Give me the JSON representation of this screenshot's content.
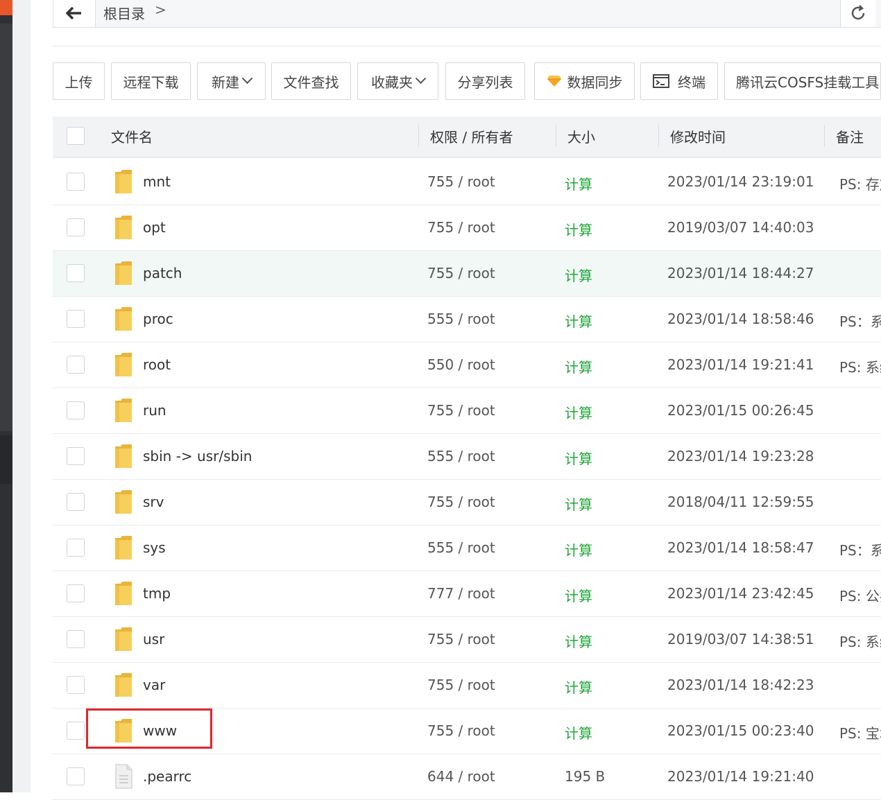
{
  "pathbar": {
    "crumb": "根目录",
    "crumb_arrow": ">"
  },
  "toolbar": {
    "buttons": [
      {
        "label": "上传"
      },
      {
        "label": "远程下载"
      },
      {
        "label": "新建"
      },
      {
        "label": "文件查找"
      },
      {
        "label": "收藏夹"
      },
      {
        "label": "分享列表"
      },
      {
        "label": "数据同步"
      },
      {
        "label": "终端"
      },
      {
        "label": "腾讯云COSFS挂载工具"
      }
    ]
  },
  "table": {
    "headers": {
      "name": "文件名",
      "perm": "权限 / 所有者",
      "size": "大小",
      "mtime": "修改时间",
      "note": "备注"
    },
    "rows": [
      {
        "name": "mnt",
        "perm": "755 / root",
        "size": "计算",
        "mtime": "2023/01/14 23:19:01",
        "note": "PS: 存放"
      },
      {
        "name": "opt",
        "perm": "755 / root",
        "size": "计算",
        "mtime": "2019/03/07 14:40:03",
        "note": ""
      },
      {
        "name": "patch",
        "perm": "755 / root",
        "size": "计算",
        "mtime": "2023/01/14 18:44:27",
        "note": ""
      },
      {
        "name": "proc",
        "perm": "555 / root",
        "size": "计算",
        "mtime": "2023/01/14 18:58:46",
        "note": "PS：系"
      },
      {
        "name": "root",
        "perm": "550 / root",
        "size": "计算",
        "mtime": "2023/01/14 19:21:41",
        "note": "PS: 系统"
      },
      {
        "name": "run",
        "perm": "755 / root",
        "size": "计算",
        "mtime": "2023/01/15 00:26:45",
        "note": ""
      },
      {
        "name": "sbin -> usr/sbin",
        "perm": "555 / root",
        "size": "计算",
        "mtime": "2023/01/14 19:23:28",
        "note": ""
      },
      {
        "name": "srv",
        "perm": "755 / root",
        "size": "计算",
        "mtime": "2018/04/11 12:59:55",
        "note": ""
      },
      {
        "name": "sys",
        "perm": "555 / root",
        "size": "计算",
        "mtime": "2023/01/14 18:58:47",
        "note": "PS：系"
      },
      {
        "name": "tmp",
        "perm": "777 / root",
        "size": "计算",
        "mtime": "2023/01/14 23:42:45",
        "note": "PS: 公共"
      },
      {
        "name": "usr",
        "perm": "755 / root",
        "size": "计算",
        "mtime": "2019/03/07 14:38:51",
        "note": "PS: 系统"
      },
      {
        "name": "var",
        "perm": "755 / root",
        "size": "计算",
        "mtime": "2023/01/14 18:42:23",
        "note": ""
      },
      {
        "name": "www",
        "perm": "755 / root",
        "size": "计算",
        "mtime": "2023/01/15 00:23:40",
        "note": "PS: 宝塔"
      },
      {
        "name": ".pearrc",
        "perm": "644 / root",
        "size": "195 B",
        "mtime": "2023/01/14 19:21:40",
        "note": ""
      }
    ]
  },
  "colors": {
    "accent_green": "#20a53a",
    "highlight_row": "#f1f8f6",
    "annotation_red": "#e0262b",
    "folder_yellow": "#f5c84a"
  }
}
